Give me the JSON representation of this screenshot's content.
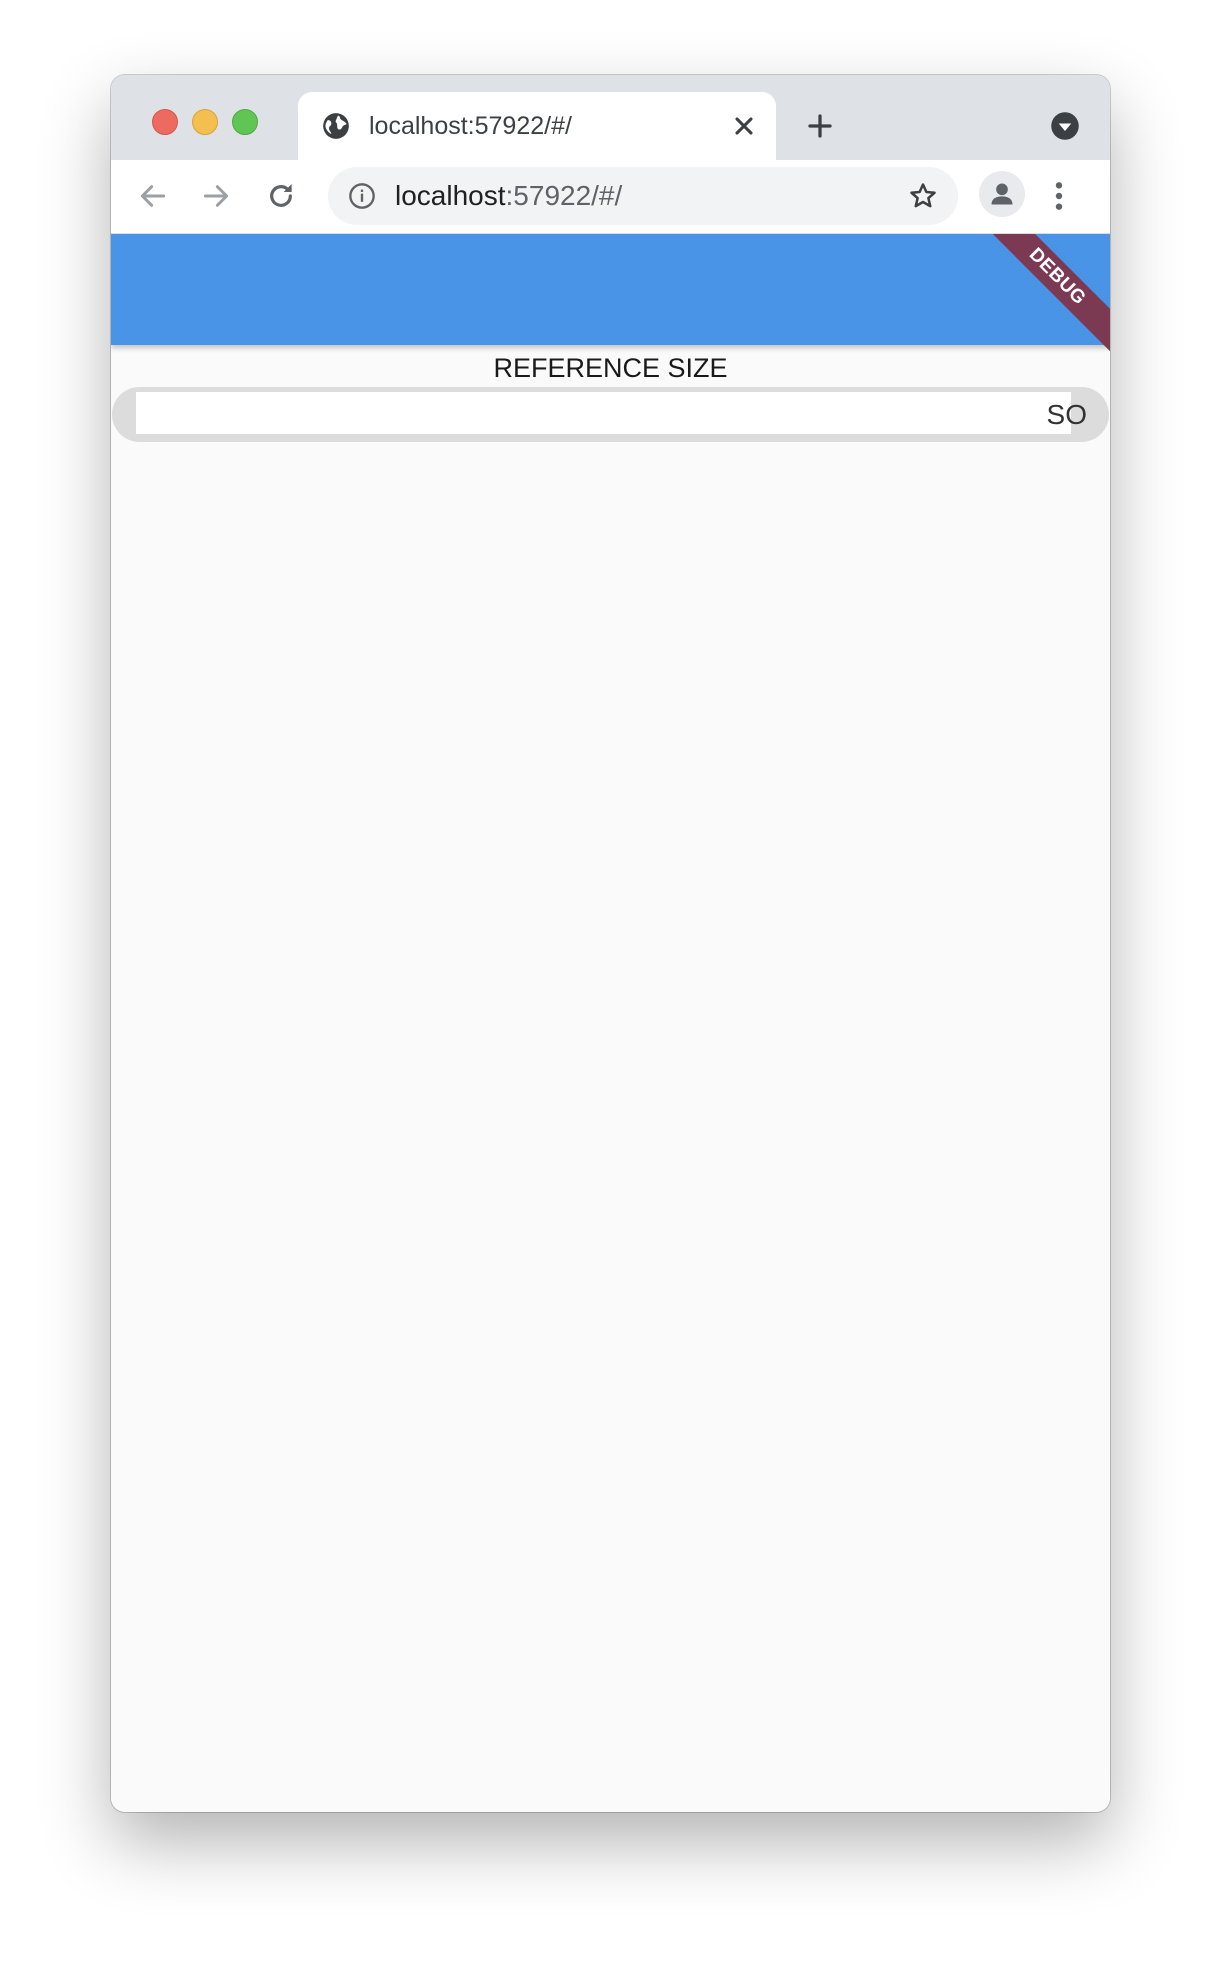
{
  "browser": {
    "tab_title": "localhost:57922/#/",
    "url_host": "localhost",
    "url_rest": ":57922/#/",
    "icons": [
      "globe-icon",
      "close-icon",
      "plus-icon",
      "chevron-down-icon",
      "back-arrow-icon",
      "forward-arrow-icon",
      "reload-icon",
      "info-icon",
      "star-icon",
      "profile-icon",
      "more-vertical-icon"
    ]
  },
  "app": {
    "appbar_color": "#4a94e8",
    "debug_label": "DEBUG",
    "reference_label": "REFERENCE SIZE",
    "track_text": "SO"
  }
}
